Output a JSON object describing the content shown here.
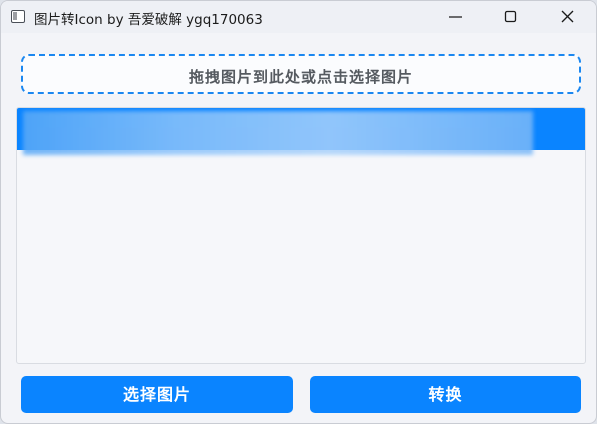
{
  "window": {
    "title": "图片转Icon by 吾爱破解 ygq170063"
  },
  "dropzone": {
    "label": "拖拽图片到此处或点击选择图片"
  },
  "list": {
    "items": [
      {
        "label": ""
      }
    ]
  },
  "buttons": {
    "select_label": "选择图片",
    "convert_label": "转换"
  },
  "icons": {
    "app": "app-window-icon",
    "minimize": "minimize-icon",
    "maximize": "maximize-icon",
    "close": "close-icon"
  },
  "colors": {
    "accent": "#0a84ff",
    "dropzone_border": "#1b87f0",
    "window_bg": "#f3f4f8"
  }
}
